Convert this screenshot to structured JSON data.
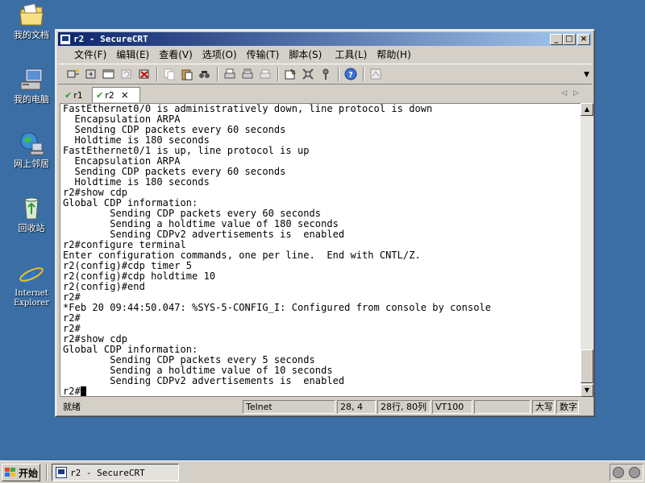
{
  "desktop": {
    "icons": [
      {
        "label": "我的文档",
        "icon": "my-documents-icon"
      },
      {
        "label": "我的电脑",
        "icon": "my-computer-icon"
      },
      {
        "label": "网上邻居",
        "icon": "network-icon"
      },
      {
        "label": "回收站",
        "icon": "recycle-bin-icon"
      },
      {
        "label_line1": "Internet",
        "label_line2": "Explorer",
        "icon": "internet-explorer-icon"
      }
    ]
  },
  "window": {
    "title": "r2 - SecureCRT",
    "controls": {
      "minimize": "_",
      "maximize": "□",
      "close": "×"
    }
  },
  "menu": [
    "文件(F)",
    "编辑(E)",
    "查看(V)",
    "选项(O)",
    "传输(T)",
    "脚本(S)",
    "工具(L)",
    "帮助(H)"
  ],
  "tabs": [
    {
      "label": "r1",
      "connected": true,
      "active": false
    },
    {
      "label": "r2",
      "connected": true,
      "active": true,
      "close": "×"
    }
  ],
  "tab_nav": {
    "left": "◁",
    "right": "▷"
  },
  "terminal": {
    "lines": [
      "FastEthernet0/0 is administratively down, line protocol is down",
      "  Encapsulation ARPA",
      "  Sending CDP packets every 60 seconds",
      "  Holdtime is 180 seconds",
      "FastEthernet0/1 is up, line protocol is up",
      "  Encapsulation ARPA",
      "  Sending CDP packets every 60 seconds",
      "  Holdtime is 180 seconds",
      "r2#show cdp",
      "Global CDP information:",
      "        Sending CDP packets every 60 seconds",
      "        Sending a holdtime value of 180 seconds",
      "        Sending CDPv2 advertisements is  enabled",
      "r2#configure terminal",
      "Enter configuration commands, one per line.  End with CNTL/Z.",
      "r2(config)#cdp timer 5",
      "r2(config)#cdp holdtime 10",
      "r2(config)#end",
      "r2#",
      "*Feb 20 09:44:50.047: %SYS-5-CONFIG_I: Configured from console by console",
      "r2#",
      "r2#",
      "r2#show cdp",
      "Global CDP information:",
      "        Sending CDP packets every 5 seconds",
      "        Sending a holdtime value of 10 seconds",
      "        Sending CDPv2 advertisements is  enabled"
    ],
    "prompt": "r2#"
  },
  "statusbar": {
    "ready": "就绪",
    "protocol": "Telnet",
    "cursor_pos": "28,  4",
    "size": "28行, 80列",
    "emulation": "VT100",
    "blank": "",
    "caps": "大写",
    "num": "数字"
  },
  "taskbar": {
    "start": "开始",
    "task": "r2 - SecureCRT"
  }
}
